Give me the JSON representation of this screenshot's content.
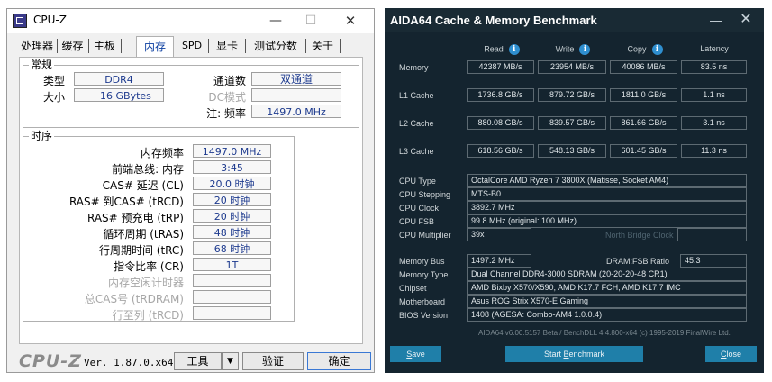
{
  "cpuz": {
    "title": "CPU-Z",
    "controls": {
      "minimize": "—",
      "maximize": "☐",
      "close": "✕"
    },
    "tabs": [
      "处理器",
      "缓存",
      "主板",
      "内存",
      "SPD",
      "显卡",
      "测试分数",
      "关于"
    ],
    "active_tab": "内存",
    "general": {
      "label": "常规",
      "type_label": "类型",
      "type_value": "DDR4",
      "size_label": "大小",
      "size_value": "16 GBytes",
      "channel_label": "通道数",
      "channel_value": "双通道",
      "dc_mode_label": "DC模式",
      "dc_mode_value": "",
      "note_label": "注: 频率",
      "note_value": "1497.0 MHz"
    },
    "timings": {
      "label": "时序",
      "rows": [
        {
          "label": "内存频率",
          "value": "1497.0 MHz",
          "disabled": false
        },
        {
          "label": "前端总线: 内存",
          "value": "3:45",
          "disabled": false
        },
        {
          "label": "CAS# 延迟 (CL)",
          "value": "20.0 时钟",
          "disabled": false
        },
        {
          "label": "RAS# 到CAS# (tRCD)",
          "value": "20 时钟",
          "disabled": false
        },
        {
          "label": "RAS# 预充电 (tRP)",
          "value": "20 时钟",
          "disabled": false
        },
        {
          "label": "循环周期 (tRAS)",
          "value": "48 时钟",
          "disabled": false
        },
        {
          "label": "行周期时间 (tRC)",
          "value": "68 时钟",
          "disabled": false
        },
        {
          "label": "指令比率 (CR)",
          "value": "1T",
          "disabled": false
        },
        {
          "label": "内存空闲计时器",
          "value": "",
          "disabled": true
        },
        {
          "label": "总CAS号 (tRDRAM)",
          "value": "",
          "disabled": true
        },
        {
          "label": "行至列 (tRCD)",
          "value": "",
          "disabled": true
        }
      ]
    },
    "footer": {
      "logo": "CPU-Z",
      "version": "Ver. 1.87.0.x64",
      "tools_label": "工具",
      "tools_arrow": "▼",
      "verify_label": "验证",
      "ok_label": "确定"
    }
  },
  "aida": {
    "title": "AIDA64 Cache & Memory Benchmark",
    "controls": {
      "minimize": "—",
      "close": "✕"
    },
    "headers": {
      "read": "Read",
      "write": "Write",
      "copy": "Copy",
      "latency": "Latency",
      "info_icon": "i"
    },
    "bench_rows": [
      {
        "label": "Memory",
        "read": "42387 MB/s",
        "write": "23954 MB/s",
        "copy": "40086 MB/s",
        "latency": "83.5 ns"
      },
      {
        "label": "L1 Cache",
        "read": "1736.8 GB/s",
        "write": "879.72 GB/s",
        "copy": "1811.0 GB/s",
        "latency": "1.1 ns"
      },
      {
        "label": "L2 Cache",
        "read": "880.08 GB/s",
        "write": "839.57 GB/s",
        "copy": "861.66 GB/s",
        "latency": "3.1 ns"
      },
      {
        "label": "L3 Cache",
        "read": "618.56 GB/s",
        "write": "548.13 GB/s",
        "copy": "601.45 GB/s",
        "latency": "11.3 ns"
      }
    ],
    "cpu_info": {
      "cpu_type_label": "CPU Type",
      "cpu_type": "OctalCore AMD Ryzen 7 3800X  (Matisse, Socket AM4)",
      "cpu_stepping_label": "CPU Stepping",
      "cpu_stepping": "MTS-B0",
      "cpu_clock_label": "CPU Clock",
      "cpu_clock": "3892.7 MHz",
      "cpu_fsb_label": "CPU FSB",
      "cpu_fsb": "99.8 MHz  (original: 100 MHz)",
      "cpu_multiplier_label": "CPU Multiplier",
      "cpu_multiplier": "39x",
      "north_bridge_label": "North Bridge Clock",
      "north_bridge_value": ""
    },
    "mem_info": {
      "memory_bus_label": "Memory Bus",
      "memory_bus": "1497.2 MHz",
      "dram_fsb_label": "DRAM:FSB Ratio",
      "dram_fsb": "45:3",
      "memory_type_label": "Memory Type",
      "memory_type": "Dual Channel DDR4-3000 SDRAM  (20-20-20-48 CR1)",
      "chipset_label": "Chipset",
      "chipset": "AMD Bixby X570/X590, AMD K17.7 FCH, AMD K17.7 IMC",
      "motherboard_label": "Motherboard",
      "motherboard": "Asus ROG Strix X570-E Gaming",
      "bios_label": "BIOS Version",
      "bios": "1408  (AGESA: Combo-AM4 1.0.0.4)"
    },
    "footnote": "AIDA64 v6.00.5157 Beta / BenchDLL 4.4.800-x64  (c) 1995-2019 FinalWire Ltd.",
    "buttons": {
      "save_first": "S",
      "save_rest": "ave",
      "bench_pre": "Start ",
      "bench_u": "B",
      "bench_post": "enchmark",
      "close_first": "C",
      "close_rest": "lose"
    }
  }
}
